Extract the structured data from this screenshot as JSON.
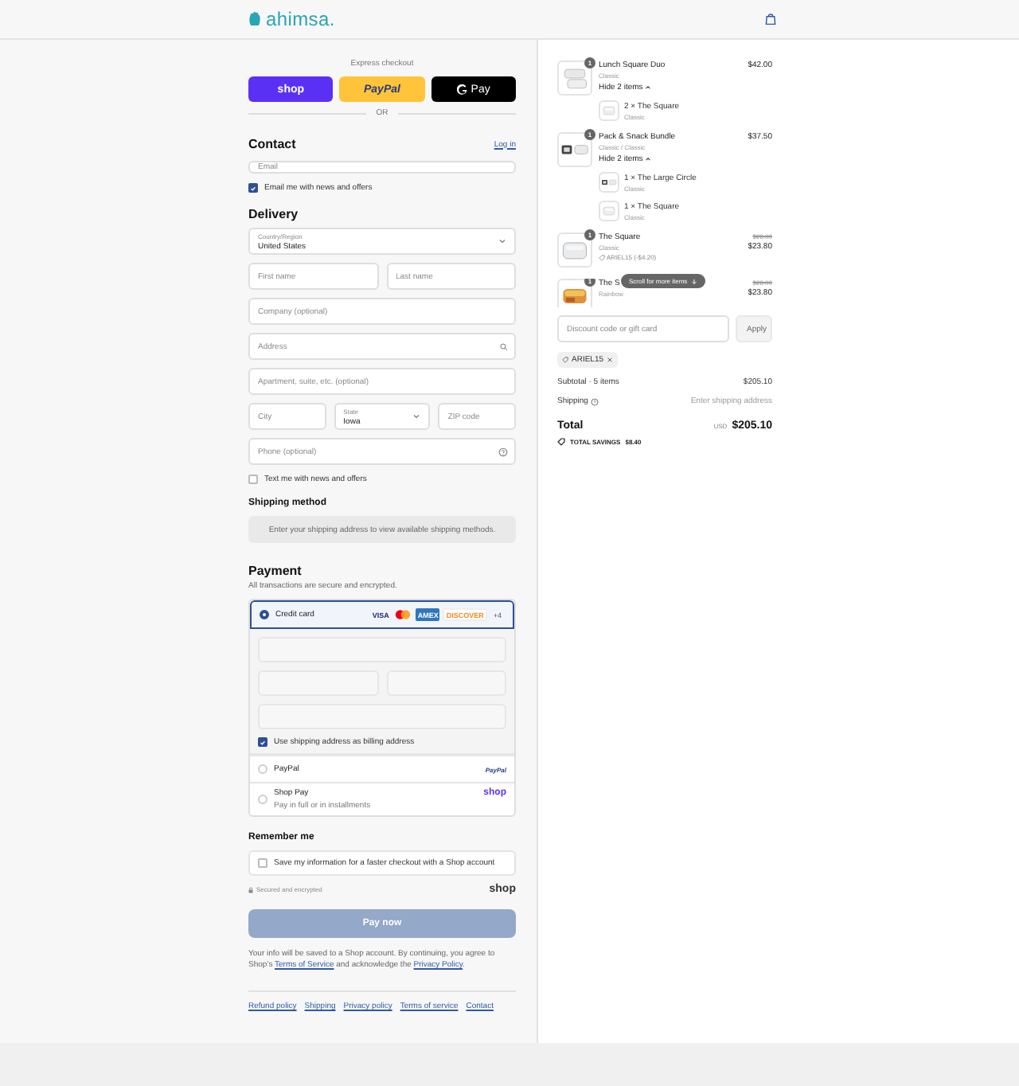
{
  "header": {
    "brand": "ahimsa."
  },
  "express": {
    "title": "Express checkout",
    "divider": "OR",
    "buttons": [
      {
        "kind": "shop",
        "label": "shop"
      },
      {
        "kind": "paypal",
        "label": "PayPal"
      },
      {
        "kind": "gpay",
        "label": "Pay"
      }
    ]
  },
  "contact": {
    "title": "Contact",
    "login": "Log in",
    "email": {
      "placeholder": "Email"
    },
    "newsletter": {
      "label": "Email me with news and offers",
      "checked": true
    }
  },
  "delivery": {
    "title": "Delivery",
    "rows": [
      [
        {
          "kind": "select",
          "label": "Country/Region",
          "value": "United States"
        }
      ],
      [
        {
          "kind": "text",
          "placeholder": "First name"
        },
        {
          "kind": "text",
          "placeholder": "Last name"
        }
      ],
      [
        {
          "kind": "text",
          "placeholder": "Company (optional)"
        }
      ],
      [
        {
          "kind": "search",
          "placeholder": "Address"
        }
      ],
      [
        {
          "kind": "text",
          "placeholder": "Apartment, suite, etc. (optional)"
        }
      ],
      [
        {
          "kind": "text",
          "placeholder": "City"
        },
        {
          "kind": "select",
          "label": "State",
          "value": "Iowa"
        },
        {
          "kind": "text",
          "placeholder": "ZIP code"
        }
      ],
      [
        {
          "kind": "help",
          "placeholder": "Phone (optional)"
        }
      ]
    ],
    "sms": {
      "label": "Text me with news and offers",
      "checked": false
    }
  },
  "shipping_method": {
    "title": "Shipping method",
    "message": "Enter your shipping address to view available shipping methods."
  },
  "payment": {
    "title": "Payment",
    "subtitle": "All transactions are secure and encrypted.",
    "methods": [
      {
        "kind": "card",
        "label": "Credit card",
        "selected": true,
        "brands": [
          {
            "kind": "visa",
            "label": "VISA"
          },
          {
            "kind": "mastercard"
          },
          {
            "kind": "amex",
            "label": "AMEX"
          },
          {
            "kind": "discover",
            "label": "DISCOVER"
          }
        ],
        "more": "+4"
      },
      {
        "kind": "paypal",
        "label": "PayPal",
        "logo": "PayPal",
        "selected": false
      },
      {
        "kind": "shoppay",
        "label": "Shop Pay",
        "note": "Pay in full or in installments",
        "logo": "shop",
        "selected": false
      }
    ],
    "billing": {
      "label": "Use shipping address as billing address",
      "checked": true
    }
  },
  "remember": {
    "title": "Remember me",
    "option": {
      "label": "Save my information for a faster checkout with a Shop account",
      "checked": false
    }
  },
  "secure": "Secured and encrypted",
  "shop_logo": "shop",
  "pay_button": {
    "label": "Pay now",
    "disabled": true
  },
  "legal": [
    {
      "kind": "text",
      "text": "Your info will be saved to a Shop account. By continuing, you agree to Shop’s "
    },
    {
      "kind": "link",
      "text": "Terms of Service"
    },
    {
      "kind": "text",
      "text": " and acknowledge the "
    },
    {
      "kind": "link",
      "text": "Privacy Policy"
    },
    {
      "kind": "text",
      "text": "."
    }
  ],
  "footer_links": [
    "Refund policy",
    "Shipping",
    "Privacy policy",
    "Terms of service",
    "Contact"
  ],
  "summary": {
    "items": [
      {
        "qty": "1",
        "name": "Lunch Square Duo",
        "variant": "Classic",
        "price": "$42.00",
        "toggle": "Hide 2 items",
        "expanded": true,
        "children": [
          {
            "name": "2 × The Square",
            "variant": "Classic"
          }
        ]
      },
      {
        "qty": "1",
        "name": "Pack & Snack Bundle",
        "variant": "Classic / Classic",
        "price": "$37.50",
        "toggle": "Hide 2 items",
        "expanded": true,
        "children": [
          {
            "name": "1 × The Large Circle",
            "variant": "Classic"
          },
          {
            "name": "1 × The Square",
            "variant": "Classic"
          }
        ]
      },
      {
        "qty": "1",
        "name": "The Square",
        "variant": "Classic",
        "discount": "ARIEL15 (-$4.20)",
        "old_price": "$28.00",
        "price": "$23.80"
      },
      {
        "qty": "1",
        "name": "The S",
        "variant": "Rainbow",
        "old_price": "$28.00",
        "price": "$23.80"
      }
    ],
    "scroll_hint": "Scroll for more items",
    "discount": {
      "placeholder": "Discount code or gift card",
      "button": "Apply"
    },
    "code": "ARIEL15",
    "subtotal": {
      "label": "Subtotal · 5 items",
      "value": "$205.10"
    },
    "shipping": {
      "label": "Shipping",
      "value": "Enter shipping address"
    },
    "total": {
      "label": "Total",
      "currency": "USD",
      "value": "$205.10"
    },
    "savings": {
      "label": "TOTAL SAVINGS",
      "value": "$8.40"
    }
  }
}
